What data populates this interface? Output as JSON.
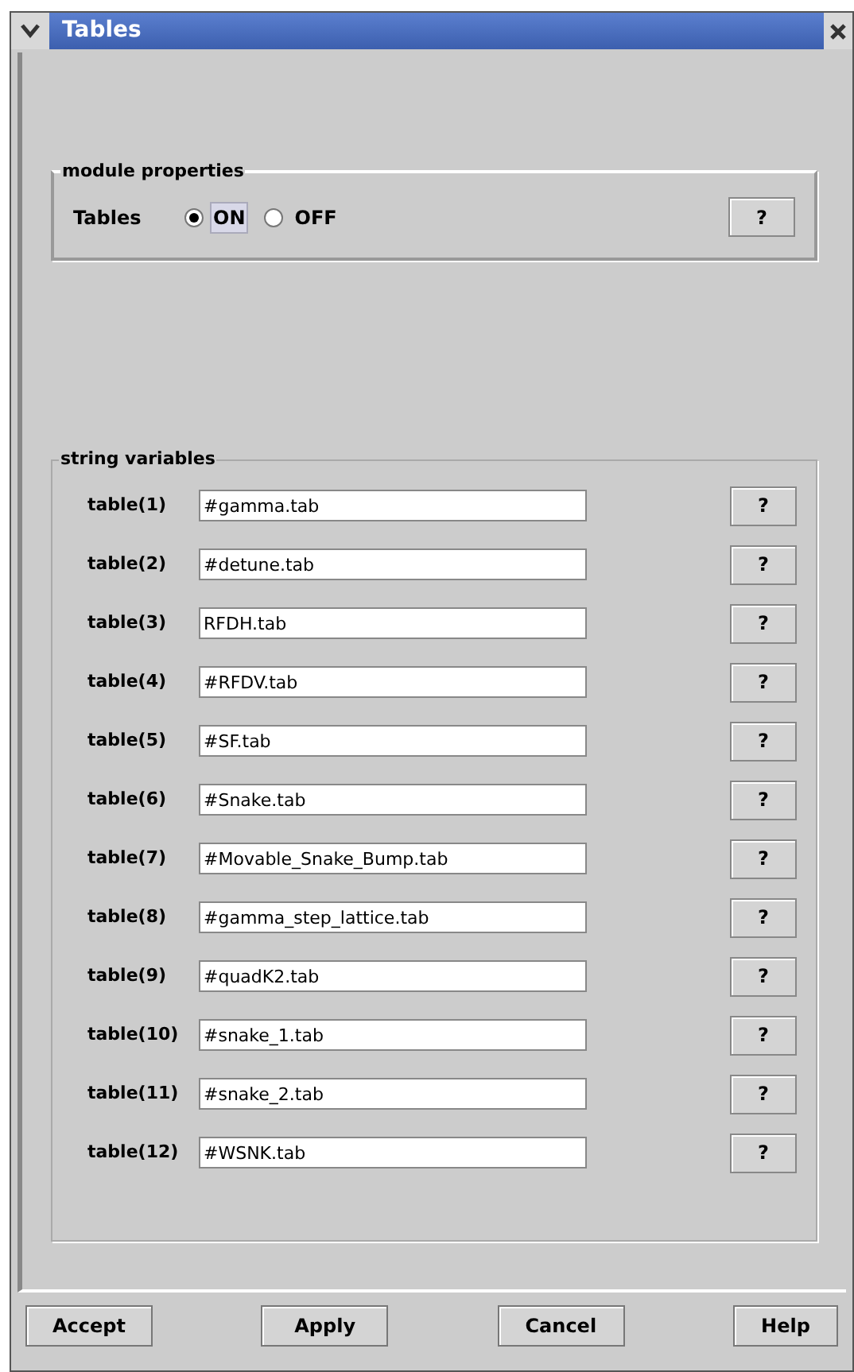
{
  "window": {
    "title": "Tables"
  },
  "module_properties": {
    "title": "module properties",
    "label": "Tables",
    "options": [
      {
        "label": "ON",
        "selected": true
      },
      {
        "label": "OFF",
        "selected": false
      }
    ],
    "help": "?"
  },
  "string_variables": {
    "title": "string variables",
    "rows": [
      {
        "label": "table(1)",
        "value": "#gamma.tab",
        "help": "?"
      },
      {
        "label": "table(2)",
        "value": "#detune.tab",
        "help": "?"
      },
      {
        "label": "table(3)",
        "value": "RFDH.tab",
        "help": "?"
      },
      {
        "label": "table(4)",
        "value": "#RFDV.tab",
        "help": "?"
      },
      {
        "label": "table(5)",
        "value": "#SF.tab",
        "help": "?"
      },
      {
        "label": "table(6)",
        "value": "#Snake.tab",
        "help": "?"
      },
      {
        "label": "table(7)",
        "value": "#Movable_Snake_Bump.tab",
        "help": "?"
      },
      {
        "label": "table(8)",
        "value": "#gamma_step_lattice.tab",
        "help": "?"
      },
      {
        "label": "table(9)",
        "value": "#quadK2.tab",
        "help": "?"
      },
      {
        "label": "table(10)",
        "value": "#snake_1.tab",
        "help": "?"
      },
      {
        "label": "table(11)",
        "value": "#snake_2.tab",
        "help": "?"
      },
      {
        "label": "table(12)",
        "value": "#WSNK.tab",
        "help": "?"
      }
    ]
  },
  "buttons": [
    "Accept",
    "Apply",
    "Cancel",
    "Help"
  ]
}
